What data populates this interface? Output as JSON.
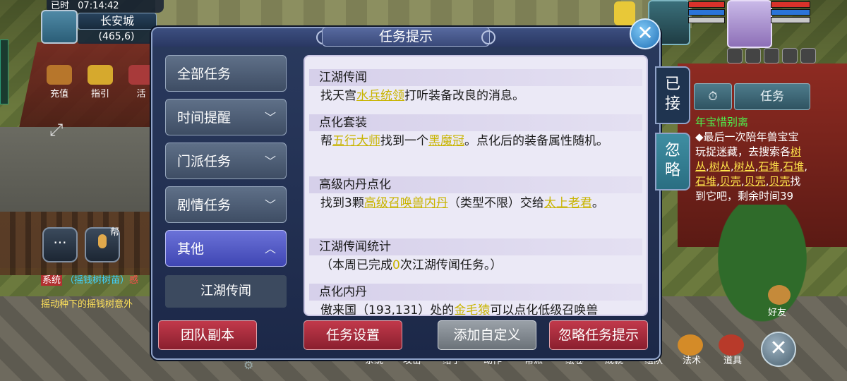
{
  "hud": {
    "clock_prefix": "已时",
    "clock_time": "07:14:42",
    "city": "长安城",
    "coords": "(465,6)",
    "top_icons": [
      "充值",
      "指引",
      "活"
    ],
    "help_label": "帮"
  },
  "chat": {
    "sys_tag": "系统",
    "line1_blue": "（摇钱树树苗）",
    "line1_red": "感",
    "line2": "摇动种下的摇钱树意外"
  },
  "dialog": {
    "title": "任务提示",
    "close_label": "✕",
    "categories": [
      {
        "label": "全部任务",
        "chevron": ""
      },
      {
        "label": "时间提醒",
        "chevron": "﹀"
      },
      {
        "label": "门派任务",
        "chevron": "﹀"
      },
      {
        "label": "剧情任务",
        "chevron": "﹀"
      },
      {
        "label": "其他",
        "chevron": "︿"
      }
    ],
    "sub_item": "江湖传闻",
    "side_tabs": [
      {
        "label": "已\n接",
        "active": true
      },
      {
        "label": "忽\n略",
        "active": false
      }
    ],
    "sections": [
      {
        "title": "江湖传闻",
        "pre": "找天宫",
        "link1": "水兵统领",
        "mid": "打听装备改良的消息。",
        "link2": "",
        "post": ""
      },
      {
        "title": "点化套装",
        "pre": "帮",
        "link1": "五行大师",
        "mid": "找到一个",
        "link2": "黑魔冠",
        "post": "。点化后的装备属性随机。"
      },
      {
        "title": "高级内丹点化",
        "pre": "找到3颗",
        "link1": "高级召唤兽内丹",
        "mid": "（类型不限）交给",
        "link2": "太上老君",
        "post": "。"
      },
      {
        "title": "江湖传闻统计",
        "pre": "（本周已完成",
        "link1": "0",
        "mid": "次江湖传闻任务。）",
        "link2": "",
        "post": ""
      },
      {
        "title": "点化内丹",
        "pre": "傲来国（193,131）处的",
        "link1": "金毛猿",
        "mid": "可以点化低级召唤兽",
        "link2": "",
        "post": ""
      }
    ],
    "footer_buttons": [
      "团队副本",
      "任务设置",
      "添加自定义",
      "忽略任务提示"
    ]
  },
  "right_panel": {
    "btn_clock": "⏱",
    "btn_task": "任务",
    "tracker_title": "年宝惜别离",
    "tracker_pre": "◆最后一次陪年兽宝宝玩捉迷藏，去搜索各",
    "tracker_links": [
      "树丛",
      "树丛",
      "树丛",
      "石堆",
      "石堆",
      "石堆",
      "贝壳",
      "贝壳",
      "贝壳"
    ],
    "tracker_post": "找到它吧，剩余时间39",
    "friend_label": "好友"
  },
  "bottom_bar": [
    "系统",
    "攻击",
    "给予",
    "动作",
    "帮派",
    "绘卷",
    "成就",
    "组队",
    "法术",
    "道具"
  ],
  "colors": {
    "highlight": "#c8b400",
    "dialog_bg": "#1c2848",
    "content_bg": "#ebe9f6",
    "active_tab": "#3f46b3",
    "footer_red": "#8a1f2e"
  }
}
